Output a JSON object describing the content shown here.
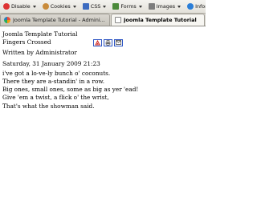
{
  "devbar": {
    "items": [
      {
        "label": "Disable",
        "icon": "disable-icon",
        "color": "#d33"
      },
      {
        "label": "Cookies",
        "icon": "cookie-icon",
        "color": "#c98b3a"
      },
      {
        "label": "CSS",
        "icon": "css-icon",
        "color": "#3d6cc0"
      },
      {
        "label": "Forms",
        "icon": "forms-icon",
        "color": "#4b8a3a"
      },
      {
        "label": "Images",
        "icon": "images-icon",
        "color": "#7d7d7d"
      },
      {
        "label": "Information",
        "icon": "information-icon",
        "color": "#2a7ed8"
      }
    ]
  },
  "tabs": [
    {
      "label": "Joomla Template Tutorial - Admini...",
      "active": false,
      "icon": "joomla-favicon"
    },
    {
      "label": "Joomla Template Tutorial",
      "active": true,
      "icon": "page-favicon"
    }
  ],
  "page": {
    "site_title": "Joomla Template Tutorial",
    "article_title": "Fingers Crossed",
    "icons": [
      "pdf-icon",
      "print-icon",
      "email-icon"
    ],
    "author": "Written by Administrator",
    "date": "Saturday, 31 January 2009 21:23",
    "body": [
      "i've got a lo-ve-ly bunch o' coconuts.",
      "There they are a-standin' in a row.",
      "Big ones, small ones, some as big as yer 'ead!",
      "Give 'em a twist, a flick o' the wrist,",
      "That's what the showman said."
    ]
  }
}
